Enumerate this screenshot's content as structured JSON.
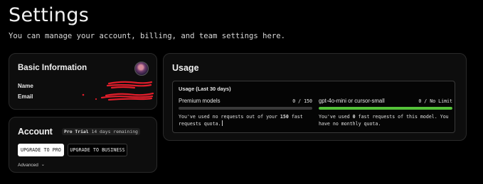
{
  "page": {
    "title": "Settings",
    "subtitle": "You can manage your account, billing, and team settings here."
  },
  "basic_info": {
    "title": "Basic Information",
    "avatar_icon": "user-avatar",
    "name_label": "Name",
    "email_label": "Email",
    "redaction_color": "#e11d2a"
  },
  "account": {
    "title": "Account",
    "plan_badge": "Pro Trial",
    "trial_remaining": "14 days remaining",
    "upgrade_pro_label": "UPGRADE TO PRO",
    "upgrade_business_label": "UPGRADE TO BUSINESS",
    "advanced_label": "Advanced",
    "advanced_icon": "chevron-down-icon"
  },
  "usage": {
    "title": "Usage",
    "period_label": "Usage (Last 30 days)",
    "quotas": [
      {
        "name": "Premium models",
        "count": "0 / 150",
        "progress_fraction": 0,
        "bar_color": "#6b6b6b",
        "note_prefix": "You've used no requests out of your ",
        "note_strong": "150",
        "note_suffix": " fast requests quota."
      },
      {
        "name": "gpt-4o-mini or cursor-small",
        "count": "0 / No Limit",
        "progress_fraction": 1,
        "bar_color": "#55c23a",
        "note_prefix": "You've used ",
        "note_strong": "0",
        "note_suffix": " fast requests of this model. You have no monthly quota."
      }
    ]
  }
}
